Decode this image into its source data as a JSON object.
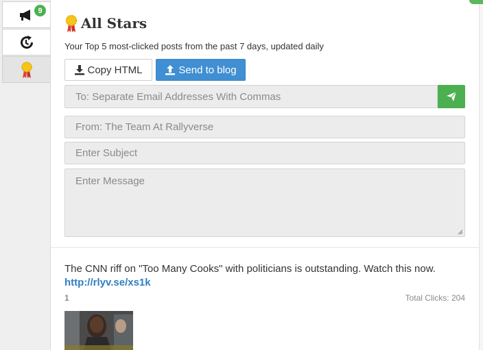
{
  "sidebar": {
    "tabs": [
      {
        "icon": "megaphone-icon",
        "badge": "9"
      },
      {
        "icon": "refresh-clock-icon"
      },
      {
        "icon": "award-ribbon-icon"
      }
    ]
  },
  "header": {
    "icon": "award-ribbon-icon",
    "title": "All Stars",
    "subtitle": "Your Top 5 most-clicked posts from the past 7 days, updated daily"
  },
  "actions": {
    "copy_label": "Copy HTML",
    "blog_label": "Send to blog"
  },
  "email_form": {
    "to_placeholder": "To: Separate Email Addresses With Commas",
    "from_value": "From: The Team At Rallyverse",
    "subject_placeholder": "Enter Subject",
    "message_placeholder": "Enter Message"
  },
  "posts": [
    {
      "text": "The CNN riff on \"Too Many Cooks\" with politicians is outstanding. Watch this now.",
      "link": "http://rlyv.se/xs1k",
      "rank": "1",
      "clicks_label": "Total Clicks: 204"
    }
  ],
  "colors": {
    "accent_blue": "#3f8fd2",
    "accent_green": "#4cb050",
    "link": "#2e7fc2"
  }
}
